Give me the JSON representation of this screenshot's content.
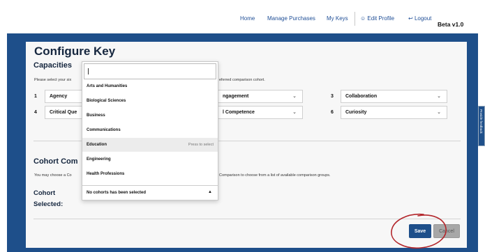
{
  "nav": {
    "home": "Home",
    "manage_purchases": "Manage Purchases",
    "my_keys": "My Keys",
    "edit_profile": "Edit Profile",
    "logout": "Logout",
    "beta": "Beta v1.0"
  },
  "page": {
    "title": "Configure Key",
    "capacities_heading": "Capacities",
    "capacities_hint_left": "Please select your six",
    "capacities_hint_right": "eferred comparison cohort.",
    "cohort_heading": "Cohort Com",
    "cohort_hint_left": "You may choose a Co",
    "cohort_hint_right": "Comparison to choose from a list of available comparison groups.",
    "cohort_selected_label_1": "Cohort",
    "cohort_selected_label_2": "Selected:"
  },
  "capacities": [
    {
      "num": "1",
      "value": "Agency"
    },
    {
      "num": "",
      "value": "ngagement"
    },
    {
      "num": "3",
      "value": "Collaboration"
    },
    {
      "num": "4",
      "value": "Critical Que"
    },
    {
      "num": "",
      "value": "l Competence"
    },
    {
      "num": "6",
      "value": "Curiosity"
    }
  ],
  "dropdown": {
    "search_value": "",
    "items": [
      "Arts and Humanities",
      "Biological Sciences",
      "Business",
      "Communications",
      "Education",
      "Engineering",
      "Health Professions"
    ],
    "highlighted_hint": "Press to select",
    "footer": "No cohorts has been selected"
  },
  "buttons": {
    "save": "Save",
    "cancel": "Cancel"
  },
  "side_tab": "Provide feedback",
  "icons": {
    "edit_profile": "user-circle-icon",
    "logout": "logout-icon",
    "chevron": "chevron-down-icon"
  },
  "colors": {
    "brand_blue": "#1e4f8a",
    "nav_link": "#1f4e96",
    "annotation_red": "#b3262b"
  }
}
